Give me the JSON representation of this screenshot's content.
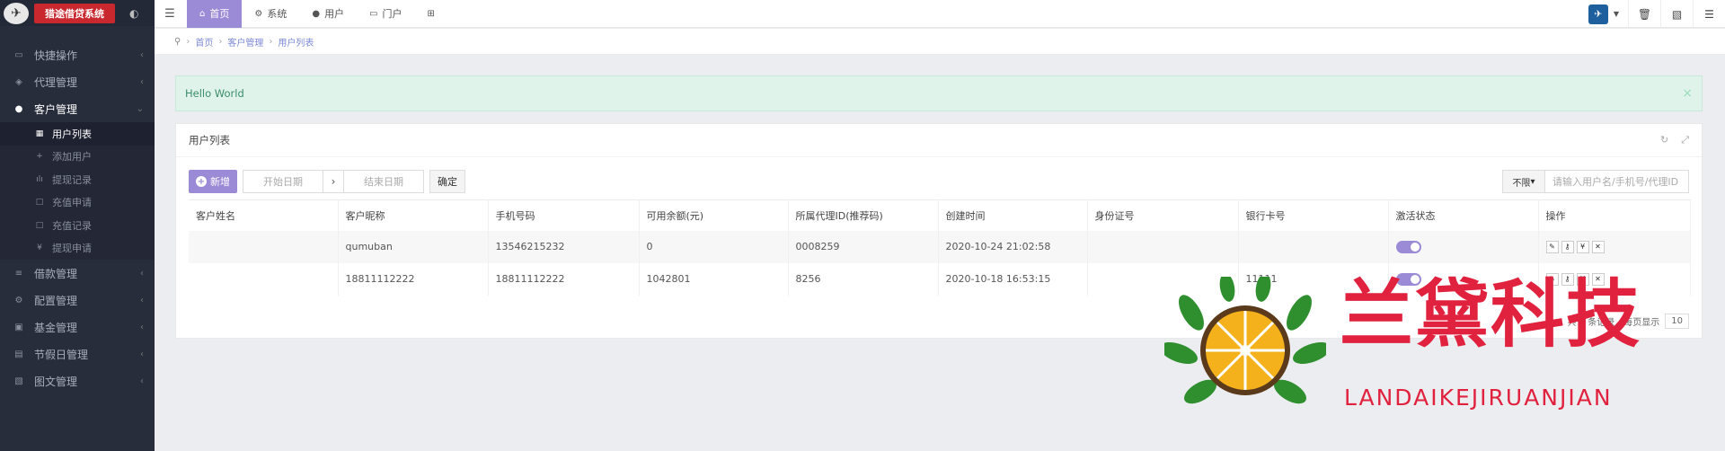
{
  "sidebar": {
    "logo_text": "猎途借贷系统",
    "items": [
      {
        "label": "快捷操作",
        "icon": "dashboard-icon"
      },
      {
        "label": "代理管理",
        "icon": "users-icon"
      },
      {
        "label": "客户管理",
        "icon": "user-icon",
        "active": true
      },
      {
        "label": "借款管理",
        "icon": "list-icon"
      },
      {
        "label": "配置管理",
        "icon": "cog-icon"
      },
      {
        "label": "基金管理",
        "icon": "money-icon"
      },
      {
        "label": "节假日管理",
        "icon": "calendar-icon"
      },
      {
        "label": "图文管理",
        "icon": "image-icon"
      }
    ],
    "sub_items": [
      {
        "label": "用户列表",
        "icon": "table-icon",
        "active": true
      },
      {
        "label": "添加用户",
        "icon": "plus-icon"
      },
      {
        "label": "提现记录",
        "icon": "chart-icon"
      },
      {
        "label": "充值申请",
        "icon": "square-icon"
      },
      {
        "label": "充值记录",
        "icon": "square-icon"
      },
      {
        "label": "提现申请",
        "icon": "yen-icon"
      }
    ]
  },
  "topbar": {
    "menu_icon": "hamburger-icon",
    "nav": [
      {
        "label": "首页",
        "icon": "home-icon",
        "active": true
      },
      {
        "label": "系统",
        "icon": "gear-icon"
      },
      {
        "label": "用户",
        "icon": "user-icon"
      },
      {
        "label": "门户",
        "icon": "portal-icon"
      },
      {
        "label": "",
        "icon": "grid-icon"
      }
    ],
    "right_buttons": [
      "trash-icon",
      "image-icon",
      "list-icon"
    ]
  },
  "breadcrumb": [
    "首页",
    "客户管理",
    "用户列表"
  ],
  "alert": {
    "text": "Hello World"
  },
  "panel": {
    "title": "用户列表",
    "toolbar": {
      "add_label": "新增",
      "start_date_placeholder": "开始日期",
      "end_date_placeholder": "结束日期",
      "confirm_label": "确定",
      "search_select": "不限",
      "search_placeholder": "请输入用户名/手机号/代理ID"
    },
    "table": {
      "headers": [
        "客户姓名",
        "客户昵称",
        "手机号码",
        "可用余额(元)",
        "所属代理ID(推荐码)",
        "创建时间",
        "身份证号",
        "银行卡号",
        "激活状态",
        "操作"
      ],
      "rows": [
        [
          "",
          "qumuban",
          "13546215232",
          "0",
          "0008259",
          "2020-10-24 21:02:58",
          "",
          "",
          "",
          ""
        ],
        [
          "",
          "18811112222",
          "18811112222",
          "1042801",
          "8256",
          "2020-10-18 16:53:15",
          "",
          "11111",
          "",
          ""
        ]
      ]
    },
    "pager": {
      "text": "共 2 条记录，每页显示",
      "size": "10"
    }
  },
  "watermark": {
    "cn": "兰黛科技",
    "en": "LANDAIKEJIRUANJIAN"
  },
  "colors": {
    "accent": "#9b8bd6",
    "sidebar": "#282d3c",
    "alert_bg": "#dff3ea",
    "watermark": "#e1223f"
  }
}
